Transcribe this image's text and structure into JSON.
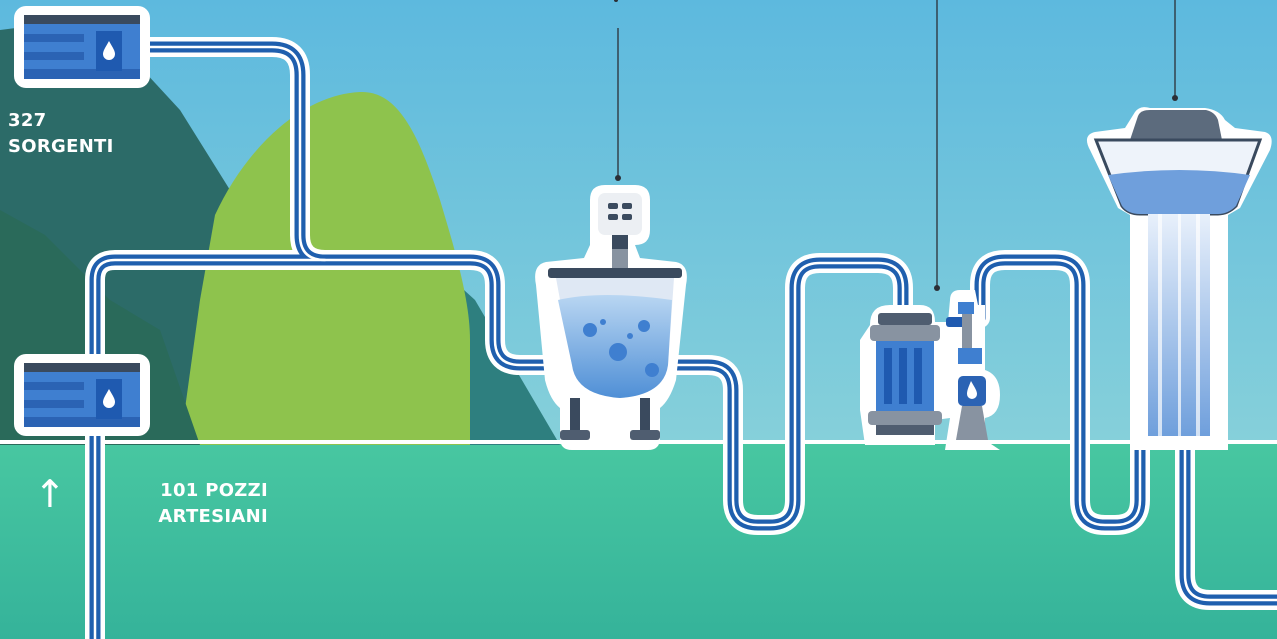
{
  "sources": {
    "springs": {
      "count": "327",
      "label": "SORGENTI"
    },
    "wells": {
      "count": "101",
      "label": "POZZI",
      "label2": "ARTESIANI"
    }
  },
  "icons": {
    "up_arrow": "↑",
    "reservoir": "reservoir-icon",
    "treatment_tank": "treatment-tank-icon",
    "filter_pump": "filter-pump-icon",
    "water_tower": "water-tower-icon"
  },
  "colors": {
    "sky": "#6cc1dd",
    "ground": "#3fbf9b",
    "hill_dark": "#2f6f66",
    "hill_light": "#8dc24e",
    "pipe": "#1f5fae",
    "accent_blue": "#2563b8"
  }
}
